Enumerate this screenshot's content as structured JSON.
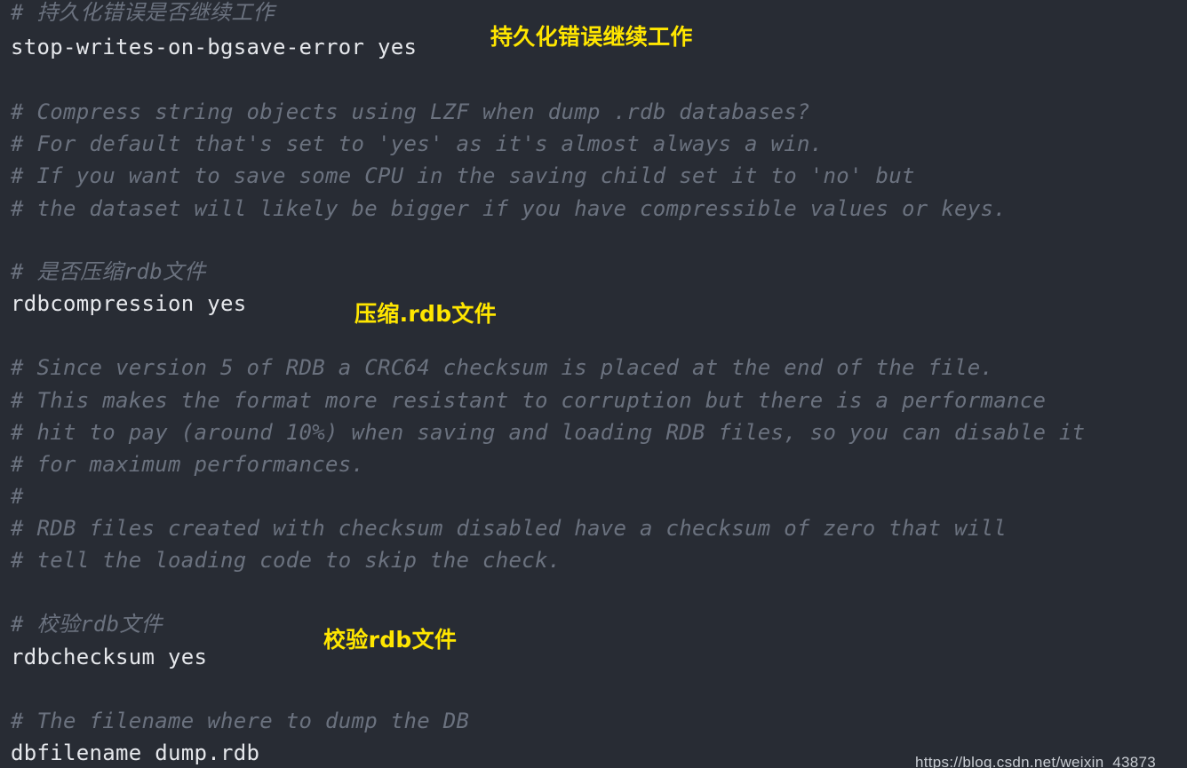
{
  "lines": [
    "# 持久化错误是否继续工作",
    "stop-writes-on-bgsave-error yes",
    "# Compress string objects using LZF when dump .rdb databases?",
    "# For default that's set to 'yes' as it's almost always a win.",
    "# If you want to save some CPU in the saving child set it to 'no' but",
    "# the dataset will likely be bigger if you have compressible values or keys.",
    "# 是否压缩rdb文件",
    "rdbcompression yes",
    "# Since version 5 of RDB a CRC64 checksum is placed at the end of the file.",
    "# This makes the format more resistant to corruption but there is a performance",
    "# hit to pay (around 10%) when saving and loading RDB files, so you can disable it",
    "# for maximum performances.",
    "#",
    "# RDB files created with checksum disabled have a checksum of zero that will",
    "# tell the loading code to skip the check.",
    "# 校验rdb文件",
    "rdbchecksum yes",
    "# The filename where to dump the DB",
    "dbfilename dump.rdb"
  ],
  "annotations": [
    "持久化错误继续工作",
    "压缩.rdb文件",
    "校验rdb文件"
  ],
  "watermark": "https://blog.csdn.net/weixin_43873"
}
